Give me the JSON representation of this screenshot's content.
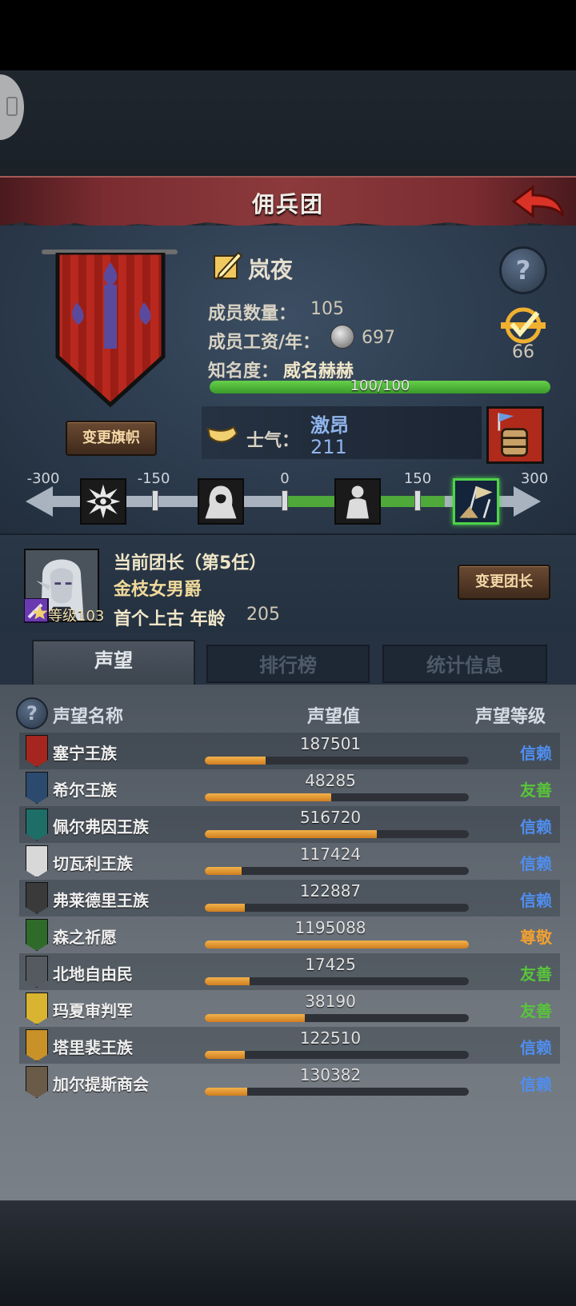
{
  "header": {
    "title": "佣兵团"
  },
  "guild": {
    "name": "岚夜",
    "members_label": "成员数量：",
    "members_value": "105",
    "salary_label": "成员工资/年：",
    "salary_value": "697",
    "fame_label": "知名度：",
    "fame_value": "威名赫赫",
    "fame_progress_text": "100/100",
    "fame_progress": 1.0,
    "task_count": "66",
    "change_flag_label": "变更旗帜",
    "morale_label": "士气：",
    "morale_state": "激昂",
    "morale_value": "211"
  },
  "morale_scale": {
    "ticks": [
      "-300",
      "-150",
      "0",
      "150",
      "300"
    ],
    "current": 211,
    "icons": [
      "eye-burst-icon",
      "hooded-figure-icon",
      "meditating-figure-icon",
      "flag-soldiers-icon"
    ]
  },
  "leader": {
    "title": "当前团长（第5任）",
    "name": "金枝女男爵",
    "level_text": "等级103",
    "stats_label": "首个上古 年龄",
    "age": "205",
    "change_leader_label": "变更团长"
  },
  "tabs": [
    {
      "label": "声望",
      "active": true
    },
    {
      "label": "排行榜",
      "active": false
    },
    {
      "label": "统计信息",
      "active": false
    }
  ],
  "reputation": {
    "headers": {
      "name": "声望名称",
      "value": "声望值",
      "level": "声望等级"
    },
    "level_colors": {
      "信赖": "#4f8ef0",
      "友善": "#58c43a",
      "尊敬": "#f0a030"
    },
    "rows": [
      {
        "name": "塞宁王族",
        "value": "187501",
        "level": "信赖",
        "progress": 0.23,
        "emblem": "#a4261e"
      },
      {
        "name": "希尔王族",
        "value": "48285",
        "level": "友善",
        "progress": 0.48,
        "emblem": "#2b4a6e"
      },
      {
        "name": "佩尔弗因王族",
        "value": "516720",
        "level": "信赖",
        "progress": 0.65,
        "emblem": "#1e6e68"
      },
      {
        "name": "切瓦利王族",
        "value": "117424",
        "level": "信赖",
        "progress": 0.14,
        "emblem": "#d8d8d8"
      },
      {
        "name": "弗莱德里王族",
        "value": "122887",
        "level": "信赖",
        "progress": 0.15,
        "emblem": "#3a3a3a"
      },
      {
        "name": "森之祈愿",
        "value": "1195088",
        "level": "尊敬",
        "progress": 1.0,
        "emblem": "#2e6a2a"
      },
      {
        "name": "北地自由民",
        "value": "17425",
        "level": "友善",
        "progress": 0.17,
        "emblem": "#555a60"
      },
      {
        "name": "玛夏审判军",
        "value": "38190",
        "level": "友善",
        "progress": 0.38,
        "emblem": "#d8b430"
      },
      {
        "name": "塔里裴王族",
        "value": "122510",
        "level": "信赖",
        "progress": 0.15,
        "emblem": "#c89228"
      },
      {
        "name": "加尔提斯商会",
        "value": "130382",
        "level": "信赖",
        "progress": 0.16,
        "emblem": "#6a5a48"
      }
    ]
  }
}
